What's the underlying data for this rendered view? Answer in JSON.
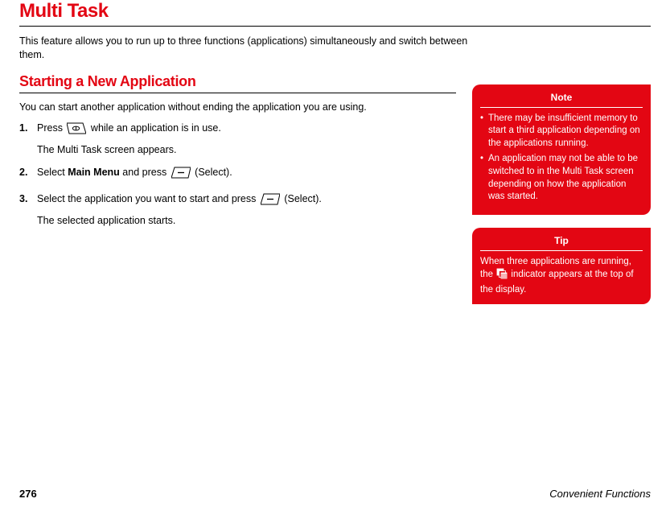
{
  "title": "Multi Task",
  "intro": "This feature allows you to run up to three functions (applications) simultaneously and switch between them.",
  "section": {
    "heading": "Starting a New Application",
    "lead": "You can start another application without ending the application you are using.",
    "steps": [
      {
        "pre": "Press ",
        "icon": "cancel-key",
        "post": " while an application is in use.",
        "sub": "The Multi Task screen appears."
      },
      {
        "pre": "Select ",
        "bold": "Main Menu",
        "mid": " and press ",
        "icon": "select-key",
        "post": " (Select)."
      },
      {
        "pre": "Select the application you want to start and press ",
        "icon": "select-key",
        "post": " (Select).",
        "sub": "The selected application starts."
      }
    ]
  },
  "note": {
    "title": "Note",
    "items": [
      "There may be insufficient memory to start a third application depending on the applications running.",
      "An application may not be able to be switched to in the Multi Task screen depending on how the application was started."
    ]
  },
  "tip": {
    "title": "Tip",
    "pre": "When three applications are running, the ",
    "icon": "multitask-indicator",
    "post": " indicator appears at the top of the display."
  },
  "footer": {
    "page": "276",
    "section": "Convenient Functions"
  }
}
